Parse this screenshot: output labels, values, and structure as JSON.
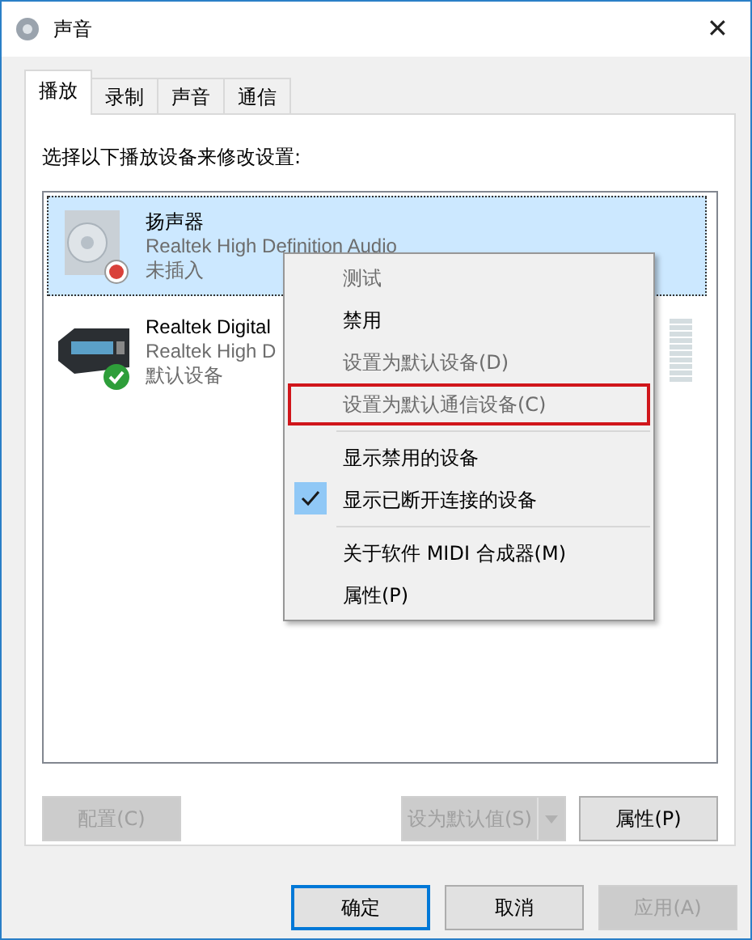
{
  "window": {
    "title": "声音",
    "close": "✕"
  },
  "tabs": [
    {
      "label": "播放",
      "selected": true
    },
    {
      "label": "录制",
      "selected": false
    },
    {
      "label": "声音",
      "selected": false
    },
    {
      "label": "通信",
      "selected": false
    }
  ],
  "instruction": "选择以下播放设备来修改设置:",
  "devices": [
    {
      "kind": "speaker",
      "name": "扬声器",
      "driver": "Realtek High Definition Audio",
      "status": "未插入",
      "selected": true
    },
    {
      "kind": "receiver",
      "name": "Realtek Digital",
      "driver": "Realtek High D",
      "status": "默认设备",
      "selected": false
    }
  ],
  "context_menu": [
    {
      "kind": "item",
      "label": "测试",
      "disabled": true,
      "checked": false,
      "annotated": false
    },
    {
      "kind": "item",
      "label": "禁用",
      "disabled": false,
      "checked": false,
      "annotated": false
    },
    {
      "kind": "item",
      "label": "设置为默认设备(D)",
      "disabled": true,
      "checked": false,
      "annotated": false
    },
    {
      "kind": "item",
      "label": "设置为默认通信设备(C)",
      "disabled": true,
      "checked": false,
      "annotated": true
    },
    {
      "kind": "separator"
    },
    {
      "kind": "item",
      "label": "显示禁用的设备",
      "disabled": false,
      "checked": false,
      "annotated": false
    },
    {
      "kind": "item",
      "label": "显示已断开连接的设备",
      "disabled": false,
      "checked": true,
      "annotated": false
    },
    {
      "kind": "separator"
    },
    {
      "kind": "item",
      "label": "关于软件 MIDI 合成器(M)",
      "disabled": false,
      "checked": false,
      "annotated": false
    },
    {
      "kind": "item",
      "label": "属性(P)",
      "disabled": false,
      "checked": false,
      "annotated": false
    }
  ],
  "panel_buttons": [
    {
      "kind": "plain",
      "label": "配置(C)",
      "disabled": true
    },
    {
      "kind": "split",
      "label": "设为默认值(S)",
      "disabled": true
    },
    {
      "kind": "plain",
      "label": "属性(P)",
      "disabled": false
    }
  ],
  "dialog_buttons": [
    {
      "label": "确定",
      "disabled": false,
      "default": true
    },
    {
      "label": "取消",
      "disabled": false,
      "default": false
    },
    {
      "label": "应用(A)",
      "disabled": true,
      "default": false
    }
  ]
}
